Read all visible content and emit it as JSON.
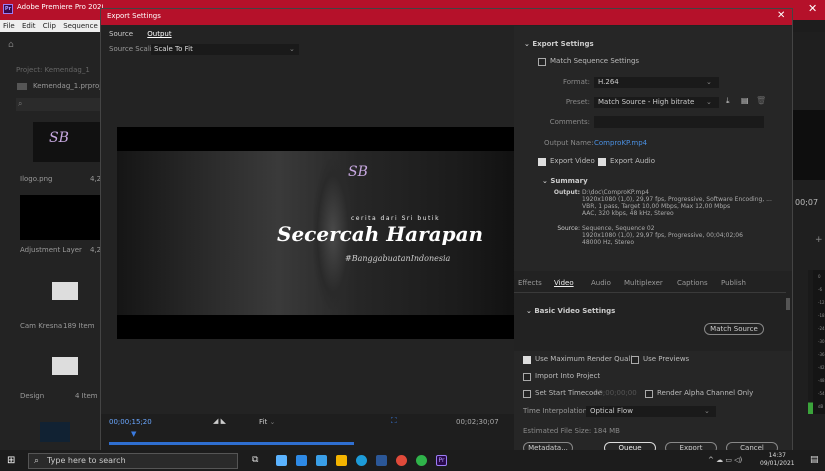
{
  "app": {
    "title": "Adobe Premiere Pro 2020",
    "close": "✕",
    "menu": [
      "File",
      "Edit",
      "Clip",
      "Sequence"
    ]
  },
  "project": {
    "title": "Project: Kemendag_1",
    "file": "Kemendag_1.prproj",
    "items": [
      {
        "name": "Ilogo.png",
        "meta": "4,2"
      },
      {
        "name": "Adjustment Layer",
        "meta": "4,2"
      },
      {
        "name": "Cam Kresna",
        "meta": "189 Item"
      },
      {
        "name": "Design",
        "meta": "4 Item"
      }
    ]
  },
  "right_edge": {
    "timecode": "00;07",
    "plus": "+"
  },
  "dialog": {
    "title": "Export Settings",
    "close": "✕",
    "tabs": {
      "source": "Source",
      "output": "Output"
    },
    "source_scaling": {
      "label": "Source Scaling:",
      "value": "Scale To Fit"
    },
    "preview": {
      "tagline": "cerita dari Sri butik",
      "title": "Secercah Harapan",
      "hashtag": "#BanggabuatanIndonesia",
      "logo": "SB"
    },
    "timeline": {
      "current": "00;00;15;20",
      "end": "00;02;30;07",
      "fit": "Fit"
    },
    "export_settings": {
      "header": "Export Settings",
      "match_sequence": "Match Sequence Settings",
      "format_label": "Format:",
      "format_value": "H.264",
      "preset_label": "Preset:",
      "preset_value": "Match Source - High bitrate",
      "comments_label": "Comments:",
      "output_name_label": "Output Name:",
      "output_name_value": "ComproKP.mp4",
      "export_video": "Export Video",
      "export_audio": "Export Audio",
      "summary_header": "Summary",
      "output_label": "Output:",
      "output_lines": [
        "D:\\doc\\ComproKP.mp4",
        "1920x1080 (1,0), 29,97 fps, Progressive, Software Encoding, ...",
        "VBR, 1 pass, Target 10,00 Mbps, Max 12,00 Mbps",
        "AAC, 320 kbps, 48 kHz, Stereo"
      ],
      "source_label": "Source:",
      "source_lines": [
        "Sequence, Sequence 02",
        "1920x1080 (1,0), 29,97 fps, Progressive, 00;04;02;06",
        "48000 Hz, Stereo"
      ]
    },
    "panel_tabs": [
      "Effects",
      "Video",
      "Audio",
      "Multiplexer",
      "Captions",
      "Publish"
    ],
    "basic_video": "Basic Video Settings",
    "match_source": "Match Source",
    "options": {
      "max_render": "Use Maximum Render Quality",
      "previews": "Use Previews",
      "import": "Import Into Project",
      "start_tc": "Set Start Timecode",
      "start_tc_value": "00;00;00;00",
      "alpha": "Render Alpha Channel Only",
      "interp_label": "Time Interpolation:",
      "interp_value": "Optical Flow",
      "filesize": "Estimated File Size: 184 MB"
    },
    "buttons": {
      "metadata": "Metadata...",
      "queue": "Queue",
      "export": "Export",
      "cancel": "Cancel"
    }
  },
  "meters": [
    "0",
    "-6",
    "-12",
    "-18",
    "-24",
    "-30",
    "-36",
    "-42",
    "-48",
    "-54",
    "dB"
  ],
  "taskbar": {
    "search": "Type here to search",
    "time": "14:37",
    "date": "09/01/2021",
    "pr": "Pr"
  },
  "colors": {
    "accent": "#b5112a",
    "timecode": "#6aa7ff",
    "playhead": "#2f6fd1"
  }
}
